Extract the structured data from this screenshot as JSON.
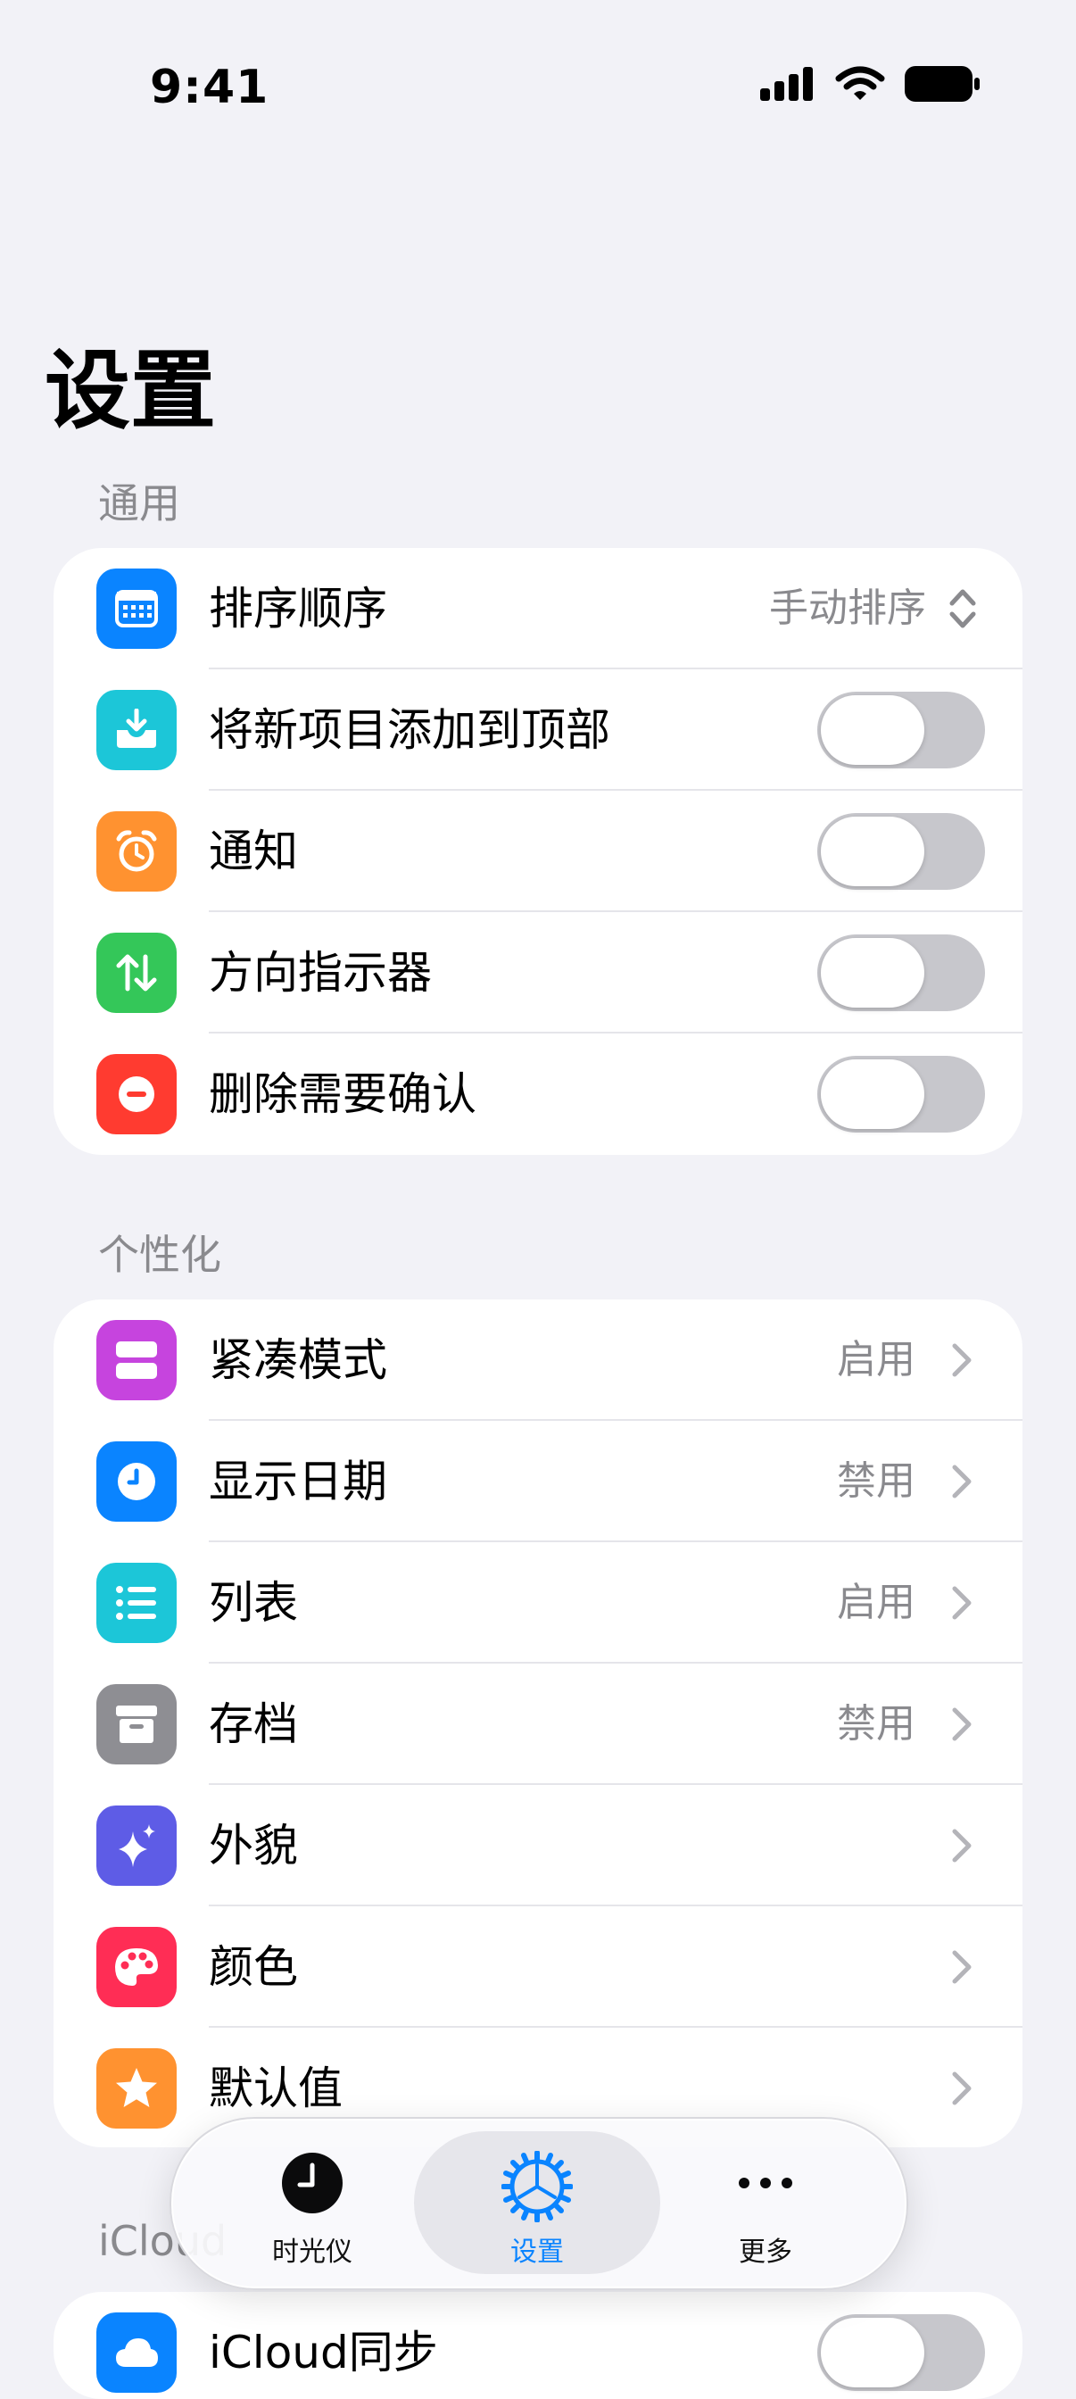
{
  "status": {
    "time": "9:41"
  },
  "title": "设置",
  "general": {
    "header": "通用",
    "sort_label": "排序顺序",
    "sort_value": "手动排序",
    "add_top_label": "将新项目添加到顶部",
    "notify_label": "通知",
    "direction_label": "方向指示器",
    "delete_label": "删除需要确认"
  },
  "personal": {
    "header": "个性化",
    "compact_label": "紧凑模式",
    "compact_value": "启用",
    "date_label": "显示日期",
    "date_value": "禁用",
    "list_label": "列表",
    "list_value": "启用",
    "archive_label": "存档",
    "archive_value": "禁用",
    "appearance_label": "外貌",
    "color_label": "颜色",
    "defaults_label": "默认值"
  },
  "icloud": {
    "header": "iCloud",
    "sync_label": "iCloud同步"
  },
  "tabbar": {
    "time_machine": "时光仪",
    "settings": "设置",
    "more": "更多"
  },
  "colors": {
    "accent": "#0A84FF",
    "blue": "#0A84FF",
    "teal": "#1CC6D8",
    "orange": "#FF9230",
    "green": "#34C759",
    "red": "#FF3B30",
    "purple": "#C644DE",
    "indigo": "#5E5CE6",
    "gray": "#8E8E93",
    "pink": "#FF2D55"
  }
}
